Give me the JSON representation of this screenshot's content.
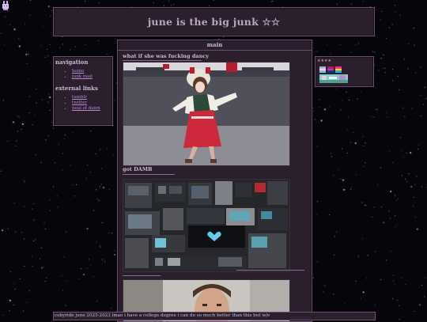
{
  "site_title": "june is the big junk ☆☆",
  "nav": {
    "heading": "navigation",
    "items": [
      "home",
      "junk mail"
    ]
  },
  "external": {
    "heading": "external links",
    "items": [
      "tumblr",
      "twitter",
      "neal of dawn"
    ]
  },
  "main": {
    "heading": "main",
    "posts": [
      {
        "title": "what if she was fucking dancy"
      },
      {
        "title": "got DAMB"
      }
    ]
  },
  "right_panel": {
    "label": "★★★★"
  },
  "footer_text": "cobyride june 2025-2023 lmao i have a college degree i can do so much better than this but w/e",
  "colors": {
    "panel_bg": "#2b1e2d",
    "panel_border": "#6b5170",
    "link": "#b78bd0",
    "page_bg": "#06050b"
  }
}
